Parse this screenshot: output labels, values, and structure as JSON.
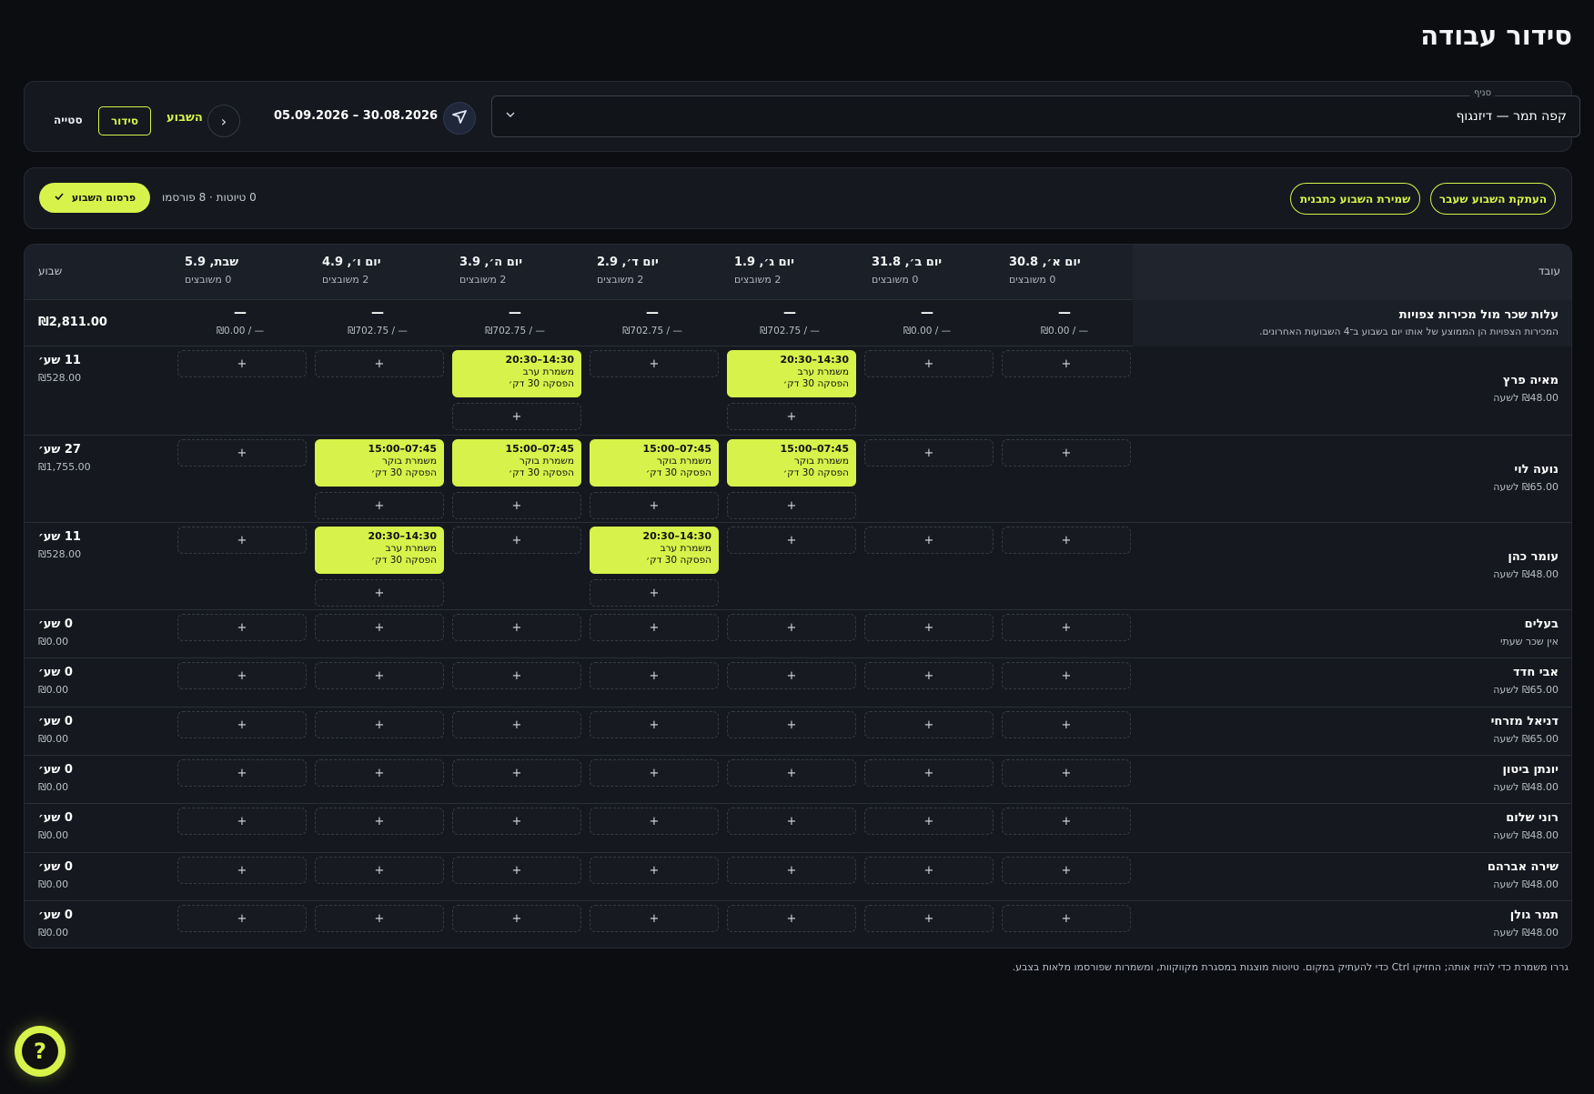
{
  "page": {
    "title": "סידור עבודה"
  },
  "header": {
    "branch_label": "סניף",
    "branch_value": "קפה תמר — דיזנגוף",
    "date_range": "05.09.2026 – 30.08.2026",
    "next_icon": "›",
    "this_week": "השבוע",
    "mode_active": "סידור",
    "mode_other": "סטייה"
  },
  "actions": {
    "copy_last_week": "העתקת השבוע שעבר",
    "save_template": "שמירת השבוע כתבנית",
    "draft_status": "0 טיוטות · 8 פורסמו",
    "publish": "פרסום השבוע"
  },
  "grid": {
    "employee_col": "עובד",
    "week_col": "שבוע",
    "days": [
      {
        "title": "יום א׳, 30.8",
        "assigned": "0 משובצים",
        "cost_dash": "—",
        "cost": "₪0.00 / —"
      },
      {
        "title": "יום ב׳, 31.8",
        "assigned": "0 משובצים",
        "cost_dash": "—",
        "cost": "₪0.00 / —"
      },
      {
        "title": "יום ג׳, 1.9",
        "assigned": "2 משובצים",
        "cost_dash": "—",
        "cost": "₪702.75 / —"
      },
      {
        "title": "יום ד׳, 2.9",
        "assigned": "2 משובצים",
        "cost_dash": "—",
        "cost": "₪702.75 / —"
      },
      {
        "title": "יום ה׳, 3.9",
        "assigned": "2 משובצים",
        "cost_dash": "—",
        "cost": "₪702.75 / —"
      },
      {
        "title": "יום ו׳, 4.9",
        "assigned": "2 משובצים",
        "cost_dash": "—",
        "cost": "₪702.75 / —"
      },
      {
        "title": "שבת, 5.9",
        "assigned": "0 משובצים",
        "cost_dash": "—",
        "cost": "₪0.00 / —"
      }
    ],
    "cost_row": {
      "title": "עלות שכר מול מכירות צפויות",
      "note": "המכירות הצפויות הן הממוצע של אותו יום בשבוע ב־4 השבועות האחרונים.",
      "total": "₪2,811.00"
    },
    "add_symbol": "+",
    "employees": [
      {
        "name": "מאיה פרץ",
        "rate": "₪48.00 לשעה",
        "hours": "11 שע׳",
        "pay": "₪528.00",
        "shifts": [
          null,
          null,
          {
            "time": "14:30–20:30",
            "type": "משמרת ערב",
            "break": "הפסקה 30 דק׳"
          },
          null,
          {
            "time": "14:30–20:30",
            "type": "משמרת ערב",
            "break": "הפסקה 30 דק׳"
          },
          null,
          null
        ]
      },
      {
        "name": "נועה לוי",
        "rate": "₪65.00 לשעה",
        "hours": "27 שע׳",
        "pay": "₪1,755.00",
        "shifts": [
          null,
          null,
          {
            "time": "07:45–15:00",
            "type": "משמרת בוקר",
            "break": "הפסקה 30 דק׳"
          },
          {
            "time": "07:45–15:00",
            "type": "משמרת בוקר",
            "break": "הפסקה 30 דק׳"
          },
          {
            "time": "07:45–15:00",
            "type": "משמרת בוקר",
            "break": "הפסקה 30 דק׳"
          },
          {
            "time": "07:45–15:00",
            "type": "משמרת בוקר",
            "break": "הפסקה 30 דק׳"
          },
          null
        ]
      },
      {
        "name": "עומר כהן",
        "rate": "₪48.00 לשעה",
        "hours": "11 שע׳",
        "pay": "₪528.00",
        "shifts": [
          null,
          null,
          null,
          {
            "time": "14:30–20:30",
            "type": "משמרת ערב",
            "break": "הפסקה 30 דק׳"
          },
          null,
          {
            "time": "14:30–20:30",
            "type": "משמרת ערב",
            "break": "הפסקה 30 דק׳"
          },
          null
        ]
      },
      {
        "name": "בעלים",
        "rate": "אין שכר שעתי",
        "hours": "0 שע׳",
        "pay": "₪0.00",
        "shifts": [
          null,
          null,
          null,
          null,
          null,
          null,
          null
        ]
      },
      {
        "name": "אבי חדד",
        "rate": "₪65.00 לשעה",
        "hours": "0 שע׳",
        "pay": "₪0.00",
        "shifts": [
          null,
          null,
          null,
          null,
          null,
          null,
          null
        ]
      },
      {
        "name": "דניאל מזרחי",
        "rate": "₪65.00 לשעה",
        "hours": "0 שע׳",
        "pay": "₪0.00",
        "shifts": [
          null,
          null,
          null,
          null,
          null,
          null,
          null
        ]
      },
      {
        "name": "יונתן ביטון",
        "rate": "₪48.00 לשעה",
        "hours": "0 שע׳",
        "pay": "₪0.00",
        "shifts": [
          null,
          null,
          null,
          null,
          null,
          null,
          null
        ]
      },
      {
        "name": "רוני שלום",
        "rate": "₪48.00 לשעה",
        "hours": "0 שע׳",
        "pay": "₪0.00",
        "shifts": [
          null,
          null,
          null,
          null,
          null,
          null,
          null
        ]
      },
      {
        "name": "שירה אברהם",
        "rate": "₪48.00 לשעה",
        "hours": "0 שע׳",
        "pay": "₪0.00",
        "shifts": [
          null,
          null,
          null,
          null,
          null,
          null,
          null
        ]
      },
      {
        "name": "תמר גולן",
        "rate": "₪48.00 לשעה",
        "hours": "0 שע׳",
        "pay": "₪0.00",
        "shifts": [
          null,
          null,
          null,
          null,
          null,
          null,
          null
        ]
      }
    ]
  },
  "footer": {
    "note": "גררו משמרת כדי להזיז אותה; החזיקו Ctrl כדי להעתיק במקום. טיוטות מוצגות במסגרת מקווקוות, ומשמרות שפורסמו מלאות בצבע."
  },
  "help": {
    "symbol": "?"
  },
  "colors": {
    "accent": "#d7f24a",
    "background": "#0b0d11",
    "panel": "#15181e"
  }
}
